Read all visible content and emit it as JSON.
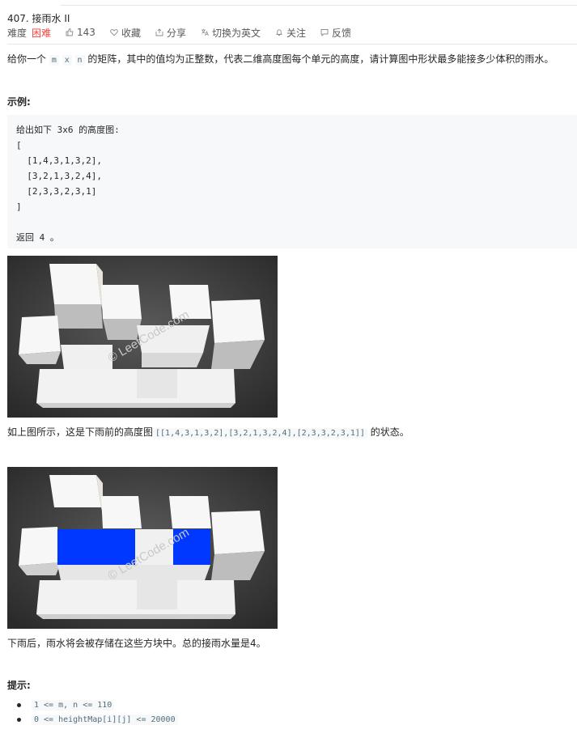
{
  "problem": {
    "title": "407. 接雨水 II",
    "difficulty_label": "难度",
    "difficulty": "困难",
    "likes": "143",
    "favorite": "收藏",
    "share": "分享",
    "switch_lang": "切换为英文",
    "follow": "关注",
    "feedback": "反馈"
  },
  "description": {
    "prefix": "给你一个 ",
    "code_m": "m",
    "code_x": "x",
    "code_n": "n",
    "suffix": " 的矩阵，其中的值均为正整数，代表二维高度图每个单元的高度，请计算图中形状最多能接多少体积的雨水。"
  },
  "example": {
    "heading": "示例:",
    "code": "给出如下 3x6 的高度图:\n[\n  [1,4,3,1,3,2],\n  [3,2,1,3,2,4],\n  [2,3,3,2,3,1]\n]\n\n返回 4 。"
  },
  "figures": {
    "watermark": "© LeetCode.com",
    "caption1_prefix": "如上图所示，这是下雨前的高度图",
    "caption1_code": "[[1,4,3,1,3,2],[3,2,1,3,2,4],[2,3,3,2,3,1]]",
    "caption1_suffix": " 的状态。",
    "caption2": "下雨后，雨水将会被存储在这些方块中。总的接雨水量是4。"
  },
  "hints": {
    "heading": "提示:",
    "items": [
      "1 <= m, n <= 110",
      "0 <= heightMap[i][j] <= 20000"
    ]
  },
  "colors": {
    "difficulty_hard": "#ef4743",
    "water": "#0038ff",
    "figure_bg": "#3a3a3a"
  }
}
